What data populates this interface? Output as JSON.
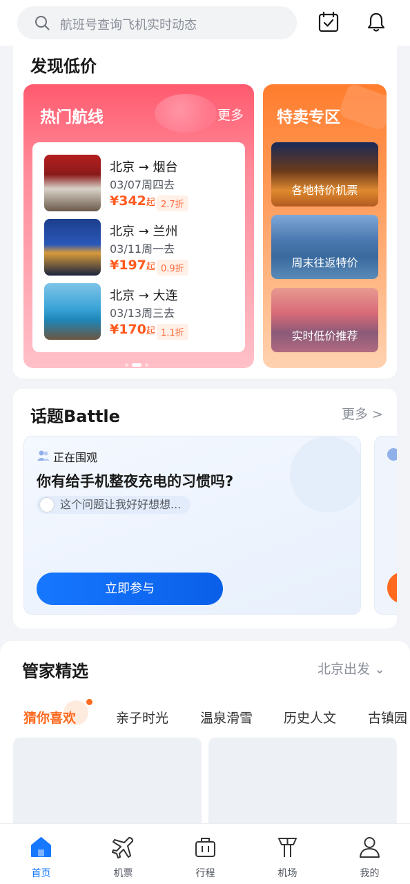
{
  "search": {
    "placeholder": "航班号查询飞机实时动态"
  },
  "discover": {
    "title": "发现低价",
    "hot": {
      "title": "热门航线",
      "more": "更多",
      "routes": [
        {
          "name": "北京 → 烟台",
          "date": "03/07周四去",
          "price": "¥342",
          "price_suffix": "起",
          "discount": "2.7折"
        },
        {
          "name": "北京 → 兰州",
          "date": "03/11周一去",
          "price": "¥197",
          "price_suffix": "起",
          "discount": "0.9折"
        },
        {
          "name": "北京 → 大连",
          "date": "03/13周三去",
          "price": "¥170",
          "price_suffix": "起",
          "discount": "1.1折"
        }
      ]
    },
    "sale": {
      "title": "特卖专区",
      "items": [
        {
          "label": "各地特价机票"
        },
        {
          "label": "周末往返特价"
        },
        {
          "label": "实时低价推荐"
        }
      ]
    }
  },
  "battle": {
    "title": "话题Battle",
    "more": "更多 >",
    "status": "正在围观",
    "question": "你有给手机整夜充电的习惯吗?",
    "reply": "这个问题让我好好想想...",
    "join": "立即参与"
  },
  "selection": {
    "title": "管家精选",
    "city": "北京出发 ⌄",
    "tabs": [
      "猜你喜欢",
      "亲子时光",
      "温泉滑雪",
      "历史人文",
      "古镇园"
    ]
  },
  "nav": {
    "items": [
      {
        "label": "首页"
      },
      {
        "label": "机票"
      },
      {
        "label": "行程"
      },
      {
        "label": "机场"
      },
      {
        "label": "我的"
      }
    ]
  },
  "colors": {
    "accent": "#1677ff",
    "price": "#ff5a1f",
    "hot": "#ff5a6e",
    "sale": "#ff7d2e"
  }
}
